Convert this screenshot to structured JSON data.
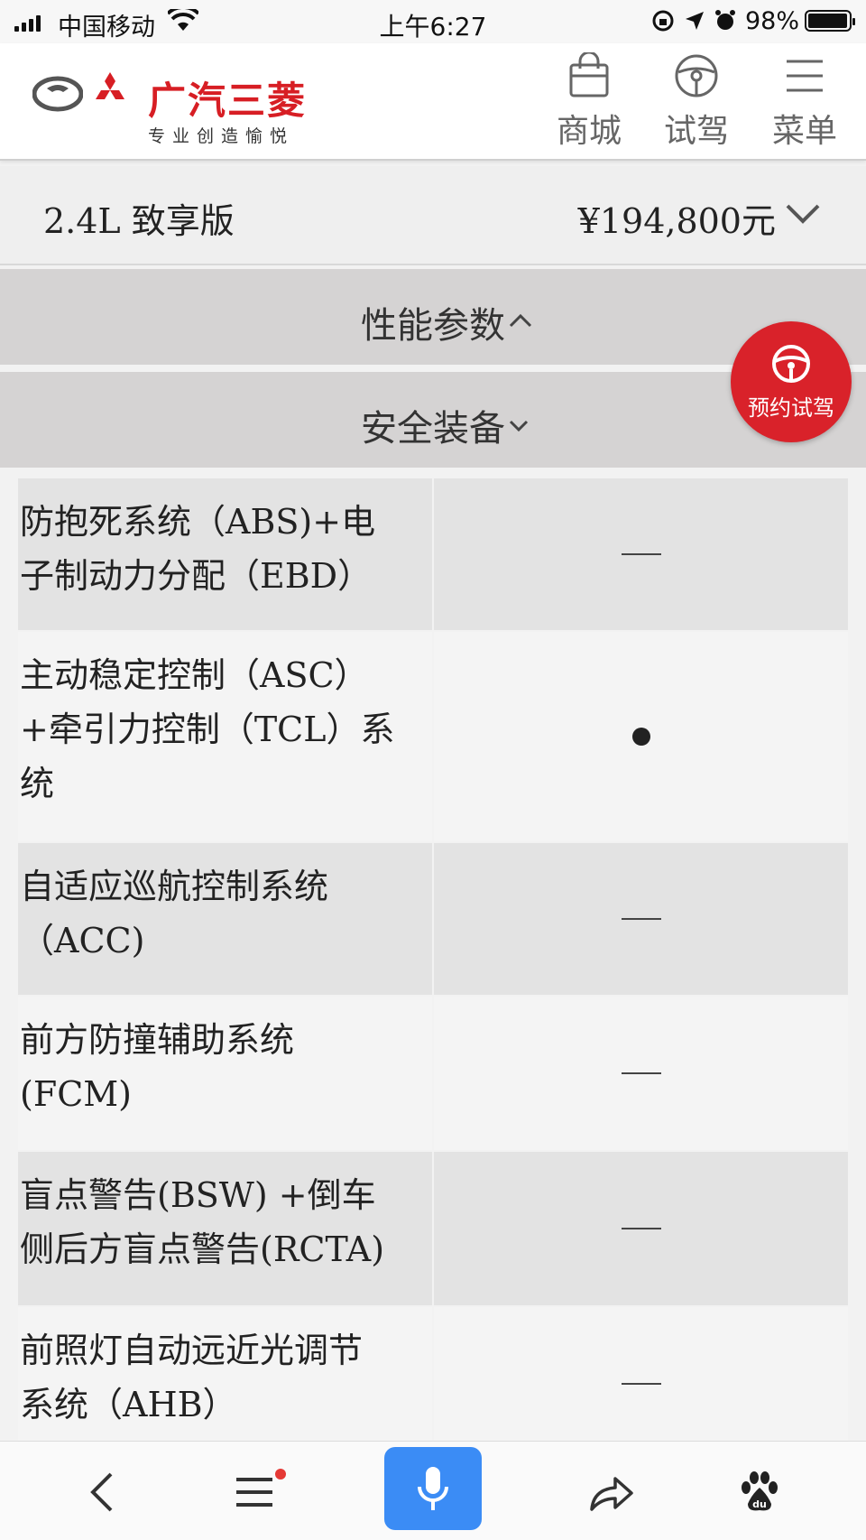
{
  "status_bar": {
    "carrier": "中国移动",
    "time": "上午6:27",
    "battery": "98%",
    "battery_level": 0.98
  },
  "header": {
    "brand_name": "广汽三菱",
    "slogan": "专业创造愉悦",
    "nav": [
      {
        "label": "商城",
        "icon": "shopping-bag-icon"
      },
      {
        "label": "试驾",
        "icon": "steering-wheel-icon"
      },
      {
        "label": "菜单",
        "icon": "menu-icon"
      }
    ]
  },
  "model": {
    "name": "2.4L 致享版",
    "price": "¥194,800元"
  },
  "sections": [
    {
      "label": "性能参数",
      "state": "expanded"
    },
    {
      "label": "安全装备",
      "state": "collapsed"
    }
  ],
  "float_button": {
    "label": "预约试驾"
  },
  "specs": [
    {
      "lines": [
        "防抱死系统（ABS)+电",
        "子制动力分配（EBD）"
      ],
      "value": "dash"
    },
    {
      "lines": [
        "主动稳定控制（ASC）",
        "+牵引力控制（TCL）系",
        "统"
      ],
      "value": "dot"
    },
    {
      "lines": [
        "自适应巡航控制系统",
        "（ACC)"
      ],
      "value": "dash"
    },
    {
      "lines": [
        "前方防撞辅助系统",
        "(FCM)"
      ],
      "value": "dash"
    },
    {
      "lines": [
        "盲点警告(BSW) +倒车",
        "侧后方盲点警告(RCTA)"
      ],
      "value": "dash"
    },
    {
      "lines": [
        "前照灯自动远近光调节",
        "系统（AHB）"
      ],
      "value": "dash"
    }
  ],
  "toolbar": [
    "back-icon",
    "menu-icon",
    "microphone-icon",
    "share-icon",
    "baidu-paw-icon"
  ],
  "colors": {
    "brand_red": "#d71e24",
    "float_red": "#d9222a",
    "mic_blue": "#3b8cf5"
  }
}
